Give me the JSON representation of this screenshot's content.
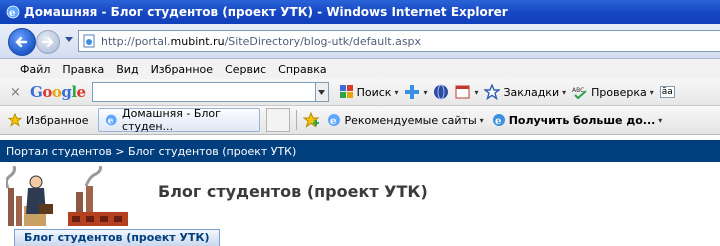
{
  "window": {
    "title": "Домашняя - Блог студентов (проект УТК) - Windows Internet Explorer"
  },
  "address_bar": {
    "prefix": "http://portal.",
    "domain": "mubint.ru",
    "path": "/SiteDirectory/blog-utk/default.aspx"
  },
  "menu": {
    "items": [
      "Файл",
      "Правка",
      "Вид",
      "Избранное",
      "Сервис",
      "Справка"
    ]
  },
  "google_toolbar": {
    "logo": "Google",
    "search_value": "",
    "search_label": "Поиск",
    "bookmarks_label": "Закладки",
    "spellcheck_label": "Проверка",
    "trailing": "ãа"
  },
  "favorites_bar": {
    "favorites_label": "Избранное",
    "tab_label": "Домашняя - Блог студен...",
    "suggested_sites": "Рекомендуемые сайты",
    "get_more": "Получить больше до..."
  },
  "page": {
    "breadcrumb": "Портал студентов > Блог студентов (проект УТК)",
    "site_title": "Блог студентов (проект УТК)",
    "nav_tab": "Блог студентов (проект УТК)"
  },
  "colors": {
    "titlebar": "#1849c4",
    "breadcrumb_bg": "#003e7e",
    "accent": "#003e7e"
  }
}
